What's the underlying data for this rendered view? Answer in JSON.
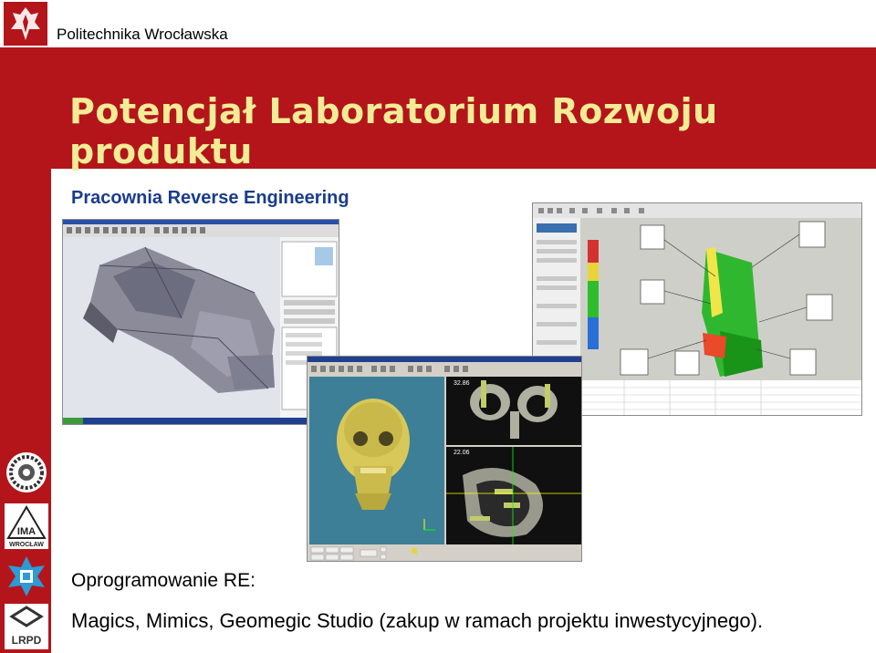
{
  "header": {
    "university": "Politechnika Wrocławska",
    "title": "Potencjał Laboratorium Rozwoju produktu"
  },
  "section": {
    "heading": "Pracownia Reverse Engineering"
  },
  "software": {
    "label": "Oprogramowanie RE:",
    "list": "Magics, Mimics, Geomegic Studio (zakup w ramach projektu inwestycyjnego)."
  },
  "screenshots": {
    "mimics_views": [
      "32.86",
      "22.06"
    ]
  },
  "side_logos": {
    "ima_text": "IMA",
    "wroclaw_text": "WROCŁAW",
    "lrpd_text": "LRPD"
  },
  "colors": {
    "brand_red": "#b3151b",
    "title_yellow": "#f3ec96",
    "heading_blue": "#1a3c8c"
  }
}
